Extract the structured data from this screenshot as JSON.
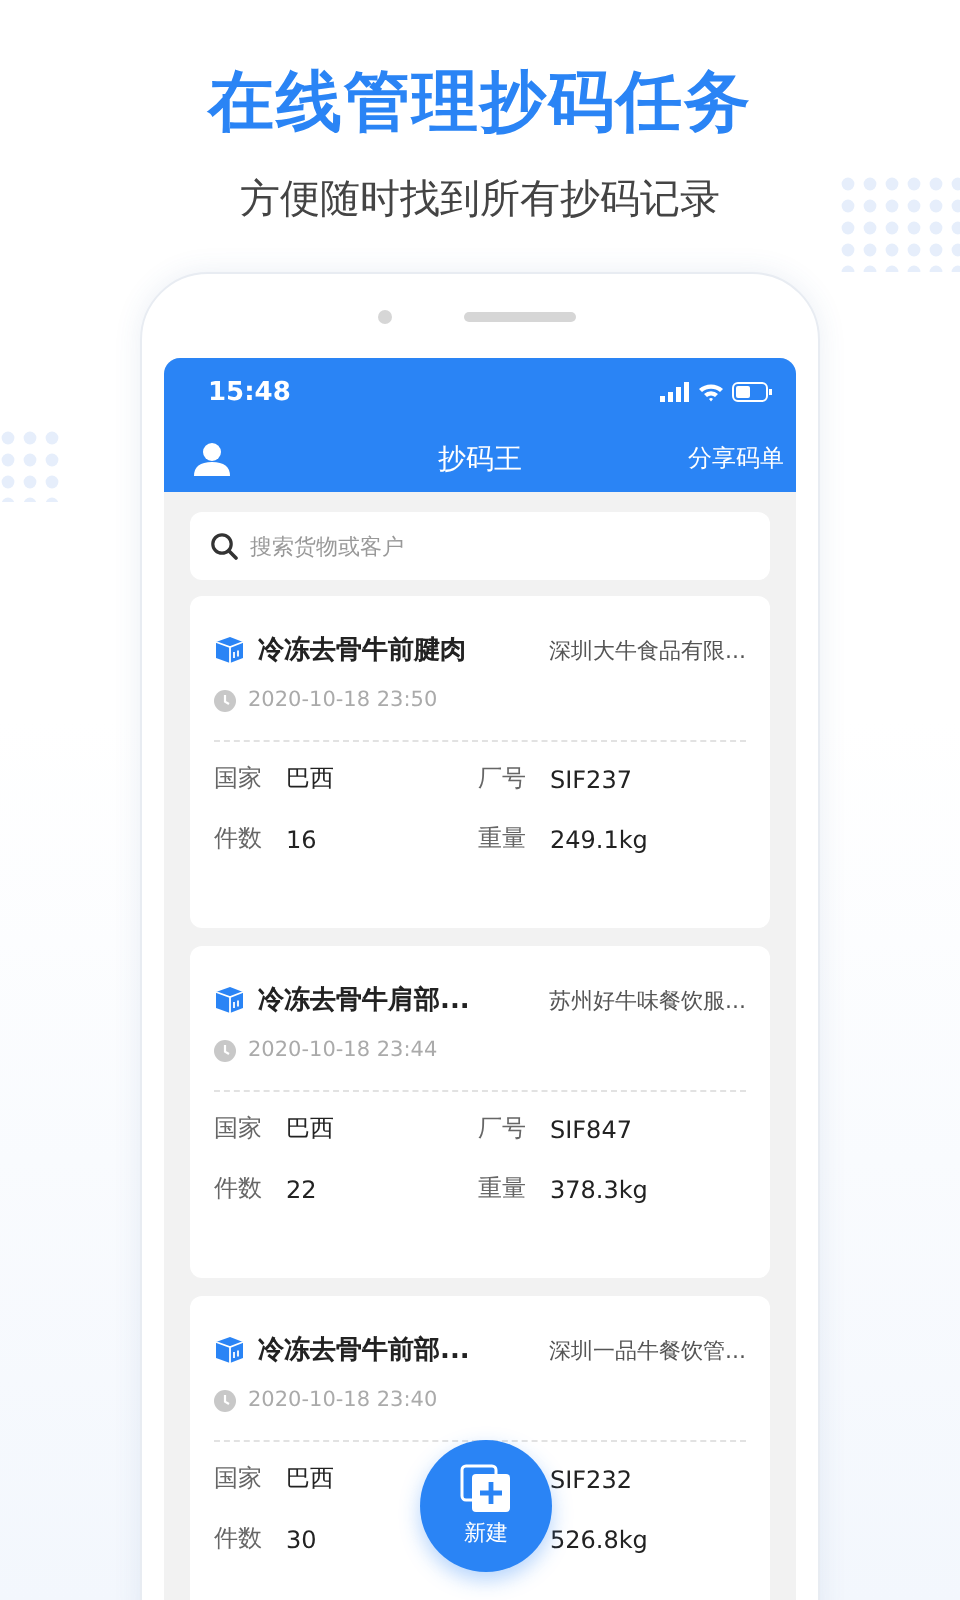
{
  "headline": "在线管理抄码任务",
  "subheadline": "方便随时找到所有抄码记录",
  "status_bar": {
    "time": "15:48"
  },
  "nav": {
    "title": "抄码王",
    "action": "分享码单"
  },
  "search": {
    "placeholder": "搜索货物或客户"
  },
  "cards": [
    {
      "title": "冷冻去骨牛前腱肉",
      "customer": "深圳大牛食品有限...",
      "time": "2020-10-18 23:50",
      "fields": [
        {
          "label": "国家",
          "value": "巴西"
        },
        {
          "label": "厂号",
          "value": "SIF237"
        },
        {
          "label": "件数",
          "value": "16"
        },
        {
          "label": "重量",
          "value": "249.1kg"
        }
      ]
    },
    {
      "title": "冷冻去骨牛肩部...",
      "customer": "苏州好牛味餐饮服...",
      "time": "2020-10-18 23:44",
      "fields": [
        {
          "label": "国家",
          "value": "巴西"
        },
        {
          "label": "厂号",
          "value": "SIF847"
        },
        {
          "label": "件数",
          "value": "22"
        },
        {
          "label": "重量",
          "value": "378.3kg"
        }
      ]
    },
    {
      "title": "冷冻去骨牛前部...",
      "customer": "深圳一品牛餐饮管...",
      "time": "2020-10-18 23:40",
      "fields": [
        {
          "label": "国家",
          "value": "巴西"
        },
        {
          "value": "SIF232"
        },
        {
          "label": "件数",
          "value": "30"
        },
        {
          "value": "526.8kg"
        }
      ]
    }
  ],
  "fab": {
    "label": "新建"
  }
}
